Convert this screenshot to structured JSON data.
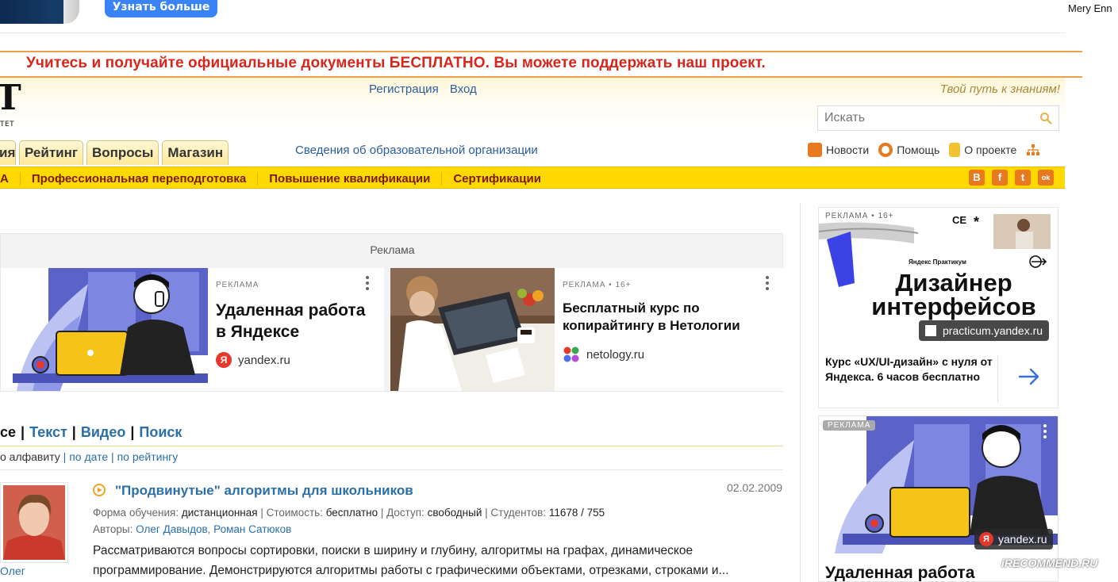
{
  "top": {
    "cta_label": "Узнать больше",
    "user_name": "Mery Enn"
  },
  "promo": {
    "text": "Учитесь и получайте официальные документы БЕСПЛАТНО. Вы можете поддержать наш проект."
  },
  "header": {
    "logo_text": "T",
    "logo_sub": "ТЕТ",
    "register": "Регистрация",
    "login": "Вход",
    "slogan": "Твой путь к знаниям!",
    "search_placeholder": "Искать",
    "tabs": [
      "ия",
      "Рейтинг",
      "Вопросы",
      "Магазин"
    ],
    "info_link": "Сведения об образовательной организации",
    "util": {
      "news": "Новости",
      "help": "Помощь",
      "about": "О проекте"
    }
  },
  "ynav": {
    "items": [
      "А",
      "Профессиональная переподготовка",
      "Повышение квалификации",
      "Сертификации"
    ],
    "social": [
      "В",
      "f",
      "t",
      "ok"
    ]
  },
  "ads": {
    "label": "Реклама",
    "cards": [
      {
        "tag": "РЕКЛАМА",
        "title": "Удаленная работа в Яндексе",
        "domain": "yandex.ru"
      },
      {
        "tag": "РЕКЛАМА • 16+",
        "title": "Бесплатный курс по копирайтингу в Нетологии",
        "domain": "netology.ru"
      }
    ]
  },
  "content": {
    "filter": {
      "current": "се",
      "links": [
        "Текст",
        "Видео",
        "Поиск"
      ]
    },
    "sort": {
      "current": "о алфавиту",
      "links": [
        "по дате",
        "по рейтингу"
      ]
    },
    "course": {
      "title": "\"Продвинутые\" алгоритмы для школьников",
      "date": "02.02.2009",
      "meta": {
        "form_label": "Форма обучения:",
        "form_value": "дистанционная",
        "cost_label": "Стоимость:",
        "cost_value": "бесплатно",
        "access_label": "Доступ:",
        "access_value": "свободный",
        "students_label": "Студентов:",
        "students_value": "11678 / 755"
      },
      "authors_label": "Авторы:",
      "authors": [
        "Олег Давыдов",
        "Роман Сатюков"
      ],
      "author_link": "Олег",
      "description": "Рассматриваются вопросы сортировки, поиски в ширину и глубину, алгоритмы на графах, динамическое программирование. Демонстрируются алгоритмы работы с графическими объектами, отрезками, строками и..."
    }
  },
  "right_ads": {
    "ad1": {
      "tag": "РЕКЛАМА • 16+",
      "brand": "Яндекс Практикум",
      "headline_1": "Дизайнер",
      "headline_2": "интерфейсов",
      "domain": "practicum.yandex.ru",
      "body": "Курс «UX/UI-дизайн» с нуля от Яндекса. 6 часов бесплатно"
    },
    "ad2": {
      "tag": "РЕКЛАМА",
      "domain": "yandex.ru",
      "title": "Удаленная работа"
    }
  },
  "watermark": "iRECOMMEND.RU",
  "colors": {
    "promo_red": "#d9261c",
    "nav_yellow": "#ffd900",
    "link_blue": "#2a6fa8",
    "brand_orange": "#e8791f"
  }
}
